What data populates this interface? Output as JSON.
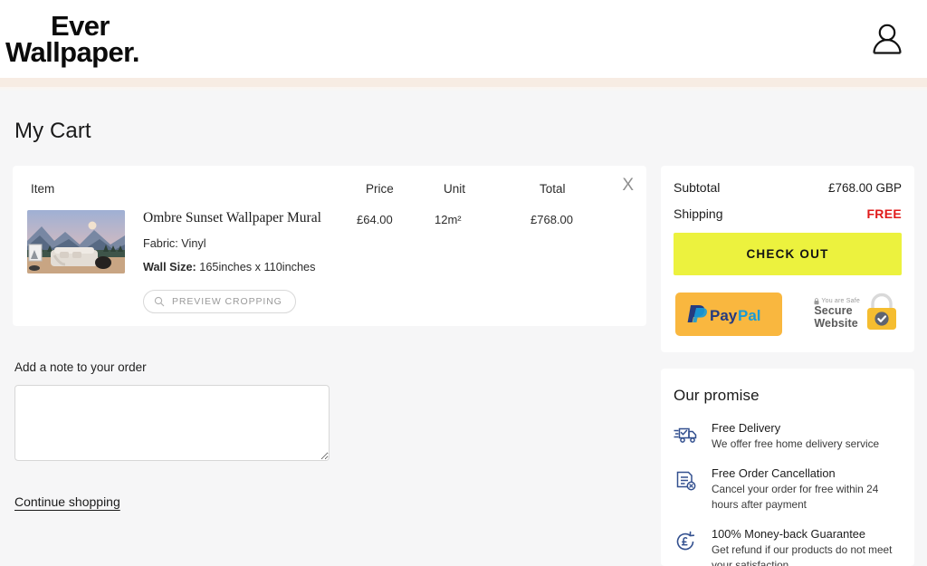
{
  "header": {
    "logo_line1": "Ever",
    "logo_line2": "Wallpaper.",
    "account_icon": "user-icon"
  },
  "page": {
    "title": "My Cart"
  },
  "cart": {
    "columns": {
      "item": "Item",
      "price": "Price",
      "unit": "Unit",
      "total": "Total"
    },
    "remove_label": "X",
    "row": {
      "title": "Ombre Sunset Wallpaper Mural",
      "fabric": "Fabric: Vinyl",
      "wall_size_label": "Wall Size:",
      "wall_size_value": "165inches x 110inches",
      "preview_button": "PREVIEW CROPPING",
      "preview_icon": "search-icon",
      "price": "£64.00",
      "unit": "12m²",
      "total": "£768.00"
    }
  },
  "note": {
    "label": "Add a note to your order",
    "value": "",
    "placeholder": ""
  },
  "continue_shopping": "Continue shopping",
  "summary": {
    "subtotal_label": "Subtotal",
    "subtotal_value": "£768.00 GBP",
    "shipping_label": "Shipping",
    "shipping_value": "FREE",
    "checkout_label": "CHECK OUT",
    "paypal_label": "PayPal",
    "secure_top": "You are Safe",
    "secure_line1": "Secure",
    "secure_line2": "Website",
    "lock_icon": "lock-icon"
  },
  "promise": {
    "title": "Our promise",
    "items": [
      {
        "icon": "delivery-truck-icon",
        "heading": "Free Delivery",
        "description": "We offer free home delivery service"
      },
      {
        "icon": "document-cancel-icon",
        "heading": "Free Order Cancellation",
        "description": "Cancel your order for free within 24 hours after payment"
      },
      {
        "icon": "refund-pound-icon",
        "heading": "100% Money-back Guarantee",
        "description": "Get refund if our products do not meet your satisfaction"
      }
    ]
  },
  "colors": {
    "checkout_bg": "#ecf23e",
    "paypal_bg": "#f9b73f",
    "shipping_free": "#e01a1a",
    "promise_icon": "#33508f",
    "header_band": "#f7ece3",
    "page_bg": "#f6f6f7"
  }
}
